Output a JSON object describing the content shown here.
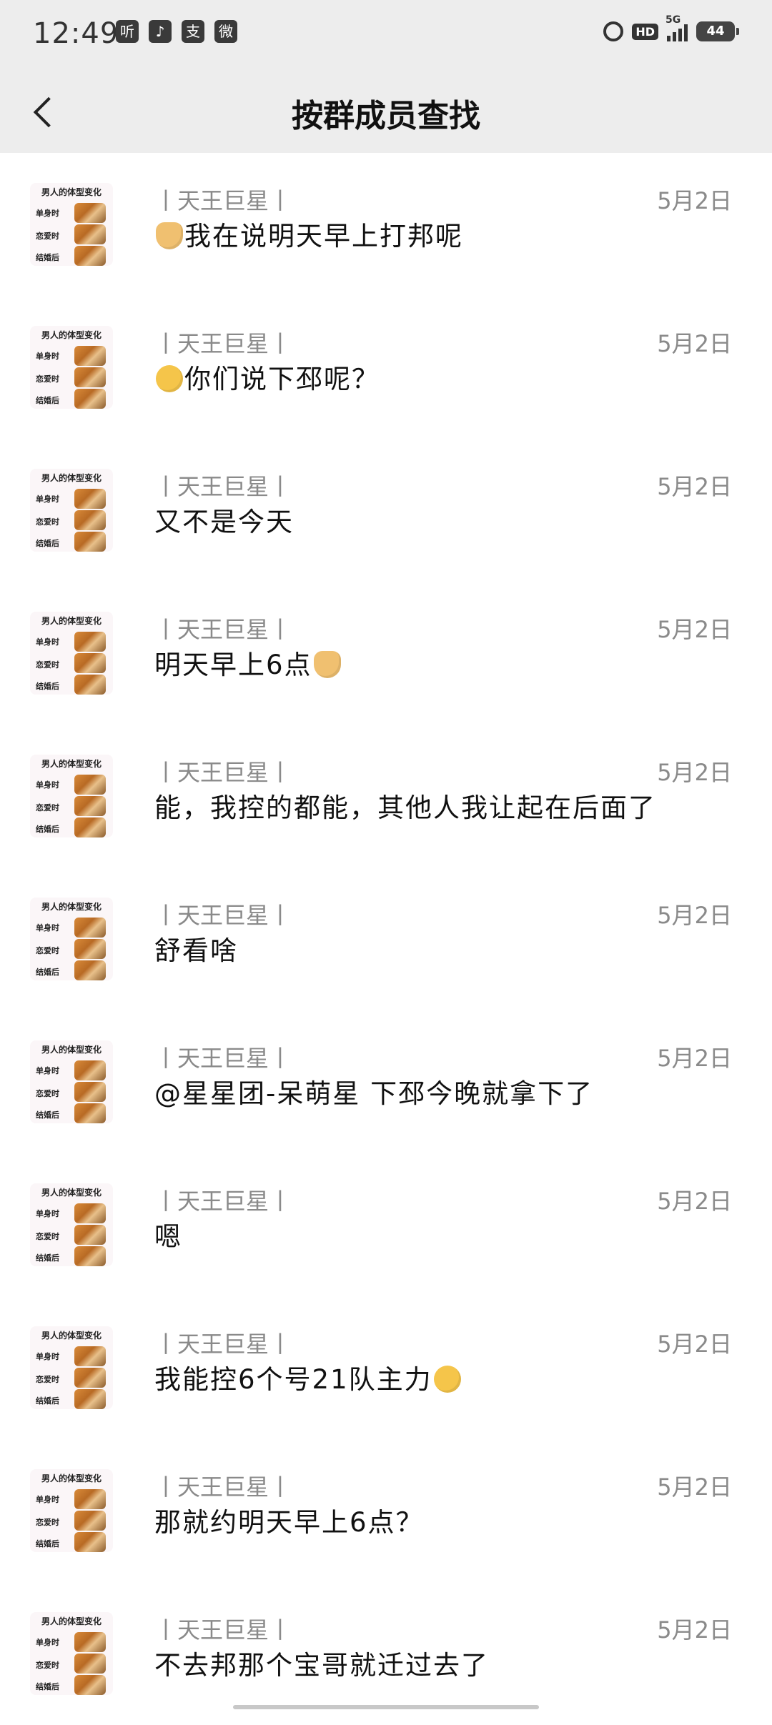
{
  "status_bar": {
    "time": "12:49",
    "apps": [
      "听",
      "♪",
      "支",
      "微"
    ],
    "hd": "HD",
    "network": "5G",
    "battery": "44"
  },
  "header": {
    "title": "按群成员查找",
    "back_icon": "chevron-left-icon"
  },
  "avatar": {
    "title": "男人的体型变化",
    "rows": [
      "单身时",
      "恋爱时",
      "结婚后"
    ]
  },
  "messages": [
    {
      "name": "丨天王巨星丨",
      "date": "5月2日",
      "text": "我在说明天早上打邦呢",
      "emoji_before": "doge"
    },
    {
      "name": "丨天王巨星丨",
      "date": "5月2日",
      "text": "你们说下邳呢？",
      "emoji_before": "think"
    },
    {
      "name": "丨天王巨星丨",
      "date": "5月2日",
      "text": "又不是今天"
    },
    {
      "name": "丨天王巨星丨",
      "date": "5月2日",
      "text": "明天早上6点",
      "emoji_after": "doge"
    },
    {
      "name": "丨天王巨星丨",
      "date": "5月2日",
      "text": "能，我控的都能，其他人我让起在后面了"
    },
    {
      "name": "丨天王巨星丨",
      "date": "5月2日",
      "text": "舒看啥"
    },
    {
      "name": "丨天王巨星丨",
      "date": "5月2日",
      "text": "@星星团-呆萌星 下邳今晚就拿下了"
    },
    {
      "name": "丨天王巨星丨",
      "date": "5月2日",
      "text": "嗯"
    },
    {
      "name": "丨天王巨星丨",
      "date": "5月2日",
      "text": "我能控6个号21队主力",
      "emoji_after": "smirk"
    },
    {
      "name": "丨天王巨星丨",
      "date": "5月2日",
      "text": "那就约明天早上6点？"
    },
    {
      "name": "丨天王巨星丨",
      "date": "5月2日",
      "text": "不去邦那个宝哥就迁过去了"
    }
  ]
}
